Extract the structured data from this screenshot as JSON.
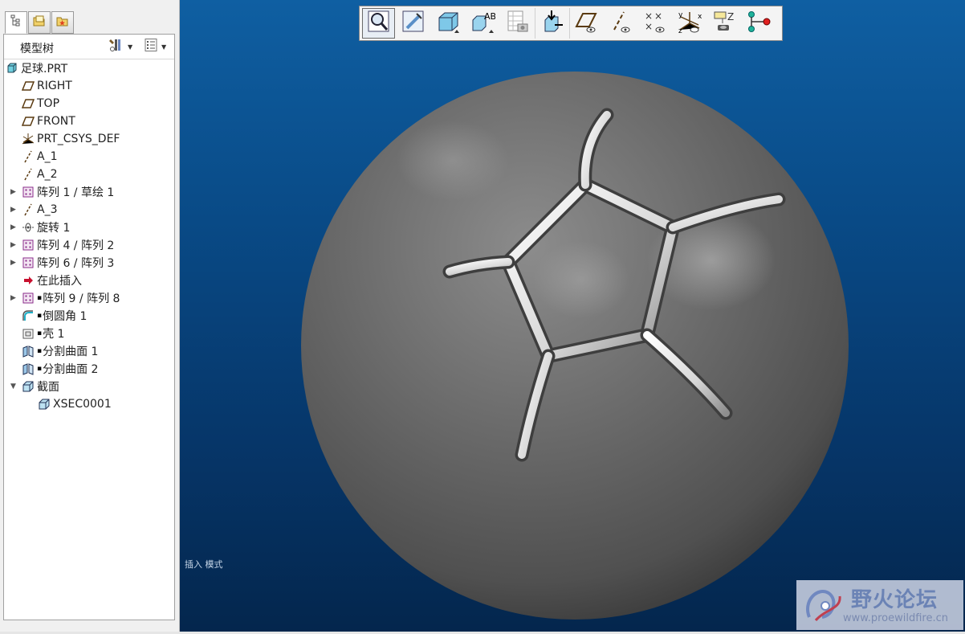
{
  "model_tree": {
    "title": "模型树",
    "nodes": [
      {
        "label": "足球.PRT",
        "icon": "part-icon",
        "expand": false,
        "mark": false
      },
      {
        "label": "RIGHT",
        "icon": "datum-plane-icon",
        "expand": false,
        "mark": false
      },
      {
        "label": "TOP",
        "icon": "datum-plane-icon",
        "expand": false,
        "mark": false
      },
      {
        "label": "FRONT",
        "icon": "datum-plane-icon",
        "expand": false,
        "mark": false
      },
      {
        "label": "PRT_CSYS_DEF",
        "icon": "coordinate-system-icon",
        "expand": false,
        "mark": false
      },
      {
        "label": "A_1",
        "icon": "datum-axis-icon",
        "expand": false,
        "mark": false
      },
      {
        "label": "A_2",
        "icon": "datum-axis-icon",
        "expand": false,
        "mark": false
      },
      {
        "label": "阵列 1 / 草绘 1",
        "icon": "pattern-icon",
        "expand": true,
        "mark": false
      },
      {
        "label": "A_3",
        "icon": "datum-axis-icon",
        "expand": true,
        "mark": false
      },
      {
        "label": "旋转 1",
        "icon": "revolve-icon",
        "expand": true,
        "mark": false
      },
      {
        "label": "阵列 4 / 阵列 2",
        "icon": "pattern-icon",
        "expand": true,
        "mark": false
      },
      {
        "label": "阵列 6 / 阵列 3",
        "icon": "pattern-icon",
        "expand": true,
        "mark": false
      },
      {
        "label": "在此插入",
        "icon": "insert-here-arrow-icon",
        "expand": false,
        "mark": false
      },
      {
        "label": "阵列 9 / 阵列 8",
        "icon": "pattern-icon",
        "expand": true,
        "mark": true
      },
      {
        "label": "倒圆角 1",
        "icon": "round-icon",
        "expand": false,
        "mark": true
      },
      {
        "label": "壳 1",
        "icon": "shell-icon",
        "expand": false,
        "mark": true
      },
      {
        "label": "分割曲面 1",
        "icon": "split-surface-icon",
        "expand": false,
        "mark": true
      },
      {
        "label": "分割曲面 2",
        "icon": "split-surface-icon",
        "expand": false,
        "mark": true
      },
      {
        "label": "截面",
        "icon": "section-folder-icon",
        "expand": true,
        "mark": false
      },
      {
        "label": "XSEC0001",
        "icon": "cross-section-icon",
        "expand": false,
        "mark": false
      }
    ]
  },
  "viewport": {
    "mode_text": "插入 模式",
    "toolbar_icons": [
      "zoom-icon",
      "repaint-icon",
      "view-orientation-icon",
      "named-views-icon",
      "saved-views-icon",
      "spin-center-icon",
      "datum-plane-display-icon",
      "datum-axis-display-icon",
      "datum-point-display-icon",
      "csys-display-icon",
      "annotation-display-icon",
      "feature-tree-display-icon"
    ]
  },
  "watermark": {
    "title": "野火论坛",
    "url": "www.proewildfire.cn"
  },
  "colors": {
    "viewport_top": "#0f5fa2",
    "viewport_bottom": "#04264d",
    "ball": "#6a6a6a"
  }
}
